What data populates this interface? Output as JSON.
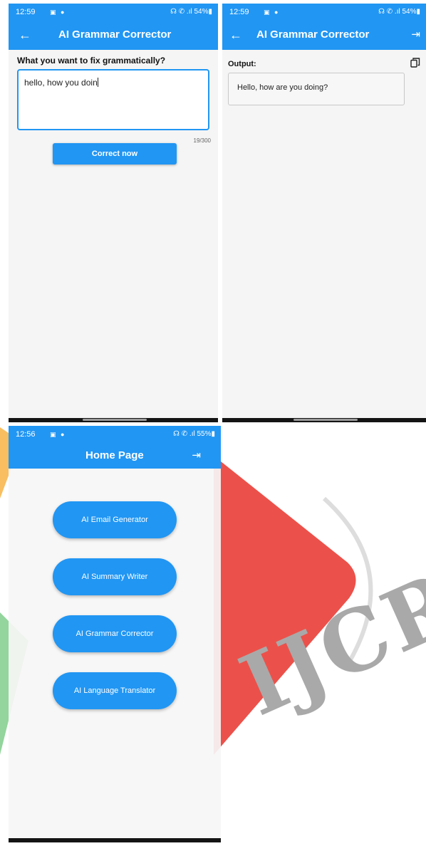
{
  "colors": {
    "primary": "#2196f3",
    "background": "#f5f5f5",
    "watermark_red": "#e8332a",
    "watermark_orange": "#f5a21d",
    "watermark_green": "#3bb34a"
  },
  "screen_corrector_input": {
    "status": {
      "time": "12:59",
      "icons": "▣ ●",
      "system": "☊ ✆ .ıl 54%▮"
    },
    "appbar": {
      "back_icon": "←",
      "title": "AI Grammar Corrector"
    },
    "question": "What you want to fix grammatically?",
    "input_value": "hello, how you doin",
    "counter": "19/300",
    "button_label": "Correct now"
  },
  "screen_corrector_output": {
    "status": {
      "time": "12:59",
      "icons": "▣ ●",
      "system": "☊ ✆ .ıl 54%▮"
    },
    "appbar": {
      "back_icon": "←",
      "title": "AI Grammar Corrector",
      "logout_icon": "⇥"
    },
    "output_label": "Output:",
    "output_value": "Hello, how are you doing?"
  },
  "screen_home": {
    "status": {
      "time": "12:56",
      "icons": "▣ ●",
      "system": "☊ ✆ .ıl 55%▮"
    },
    "appbar": {
      "title": "Home Page",
      "logout_icon": "⇥"
    },
    "buttons": [
      {
        "label": "AI Email Generator"
      },
      {
        "label": "AI Summary Writer"
      },
      {
        "label": "AI Grammar Corrector"
      },
      {
        "label": "AI Language Translator"
      }
    ]
  },
  "watermark": {
    "text": "IJCRT"
  }
}
